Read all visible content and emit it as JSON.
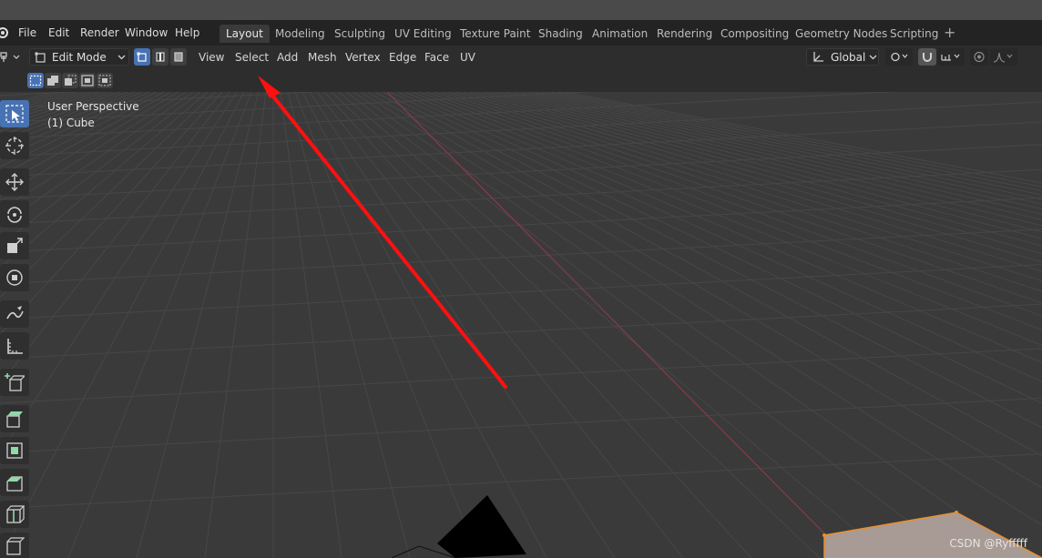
{
  "menu": [
    "File",
    "Edit",
    "Render",
    "Window",
    "Help"
  ],
  "workspaces": [
    "Layout",
    "Modeling",
    "Sculpting",
    "UV Editing",
    "Texture Paint",
    "Shading",
    "Animation",
    "Rendering",
    "Compositing",
    "Geometry Nodes",
    "Scripting"
  ],
  "active_workspace": "Layout",
  "header": {
    "mode": "Edit Mode",
    "menus": [
      "View",
      "Select",
      "Add",
      "Mesh",
      "Vertex",
      "Edge",
      "Face",
      "UV"
    ],
    "transform_orientation": "Global"
  },
  "viewport": {
    "perspective_label": "User Perspective",
    "object_label": "(1) Cube"
  },
  "toolbar_tools": [
    "select-box",
    "cursor",
    "move",
    "rotate",
    "scale",
    "transform",
    "annotate",
    "measure",
    "add-cube",
    "extrude",
    "inset",
    "bevel",
    "loop-cut",
    "knife"
  ],
  "watermark": "CSDN @Ryfffff",
  "colors": {
    "active_blue": "#4772b3",
    "x_axis_red": "#a23a4a",
    "arrow_red": "#ff1010",
    "cube_face": "#a89a94",
    "cube_edge": "#e89030"
  }
}
